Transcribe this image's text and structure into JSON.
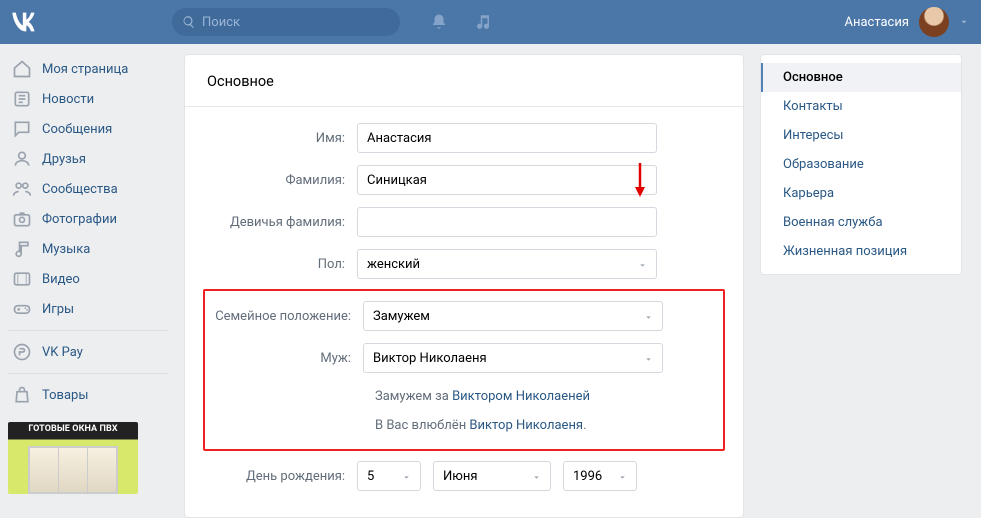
{
  "header": {
    "search_placeholder": "Поиск",
    "user_name": "Анастасия"
  },
  "leftnav": {
    "items": [
      {
        "label": "Моя страница",
        "icon": "home"
      },
      {
        "label": "Новости",
        "icon": "news"
      },
      {
        "label": "Сообщения",
        "icon": "messages"
      },
      {
        "label": "Друзья",
        "icon": "friends"
      },
      {
        "label": "Сообщества",
        "icon": "groups"
      },
      {
        "label": "Фотографии",
        "icon": "photos"
      },
      {
        "label": "Музыка",
        "icon": "music"
      },
      {
        "label": "Видео",
        "icon": "video"
      },
      {
        "label": "Игры",
        "icon": "games"
      }
    ],
    "items2": [
      {
        "label": "VK Pay",
        "icon": "pay"
      }
    ],
    "items3": [
      {
        "label": "Товары",
        "icon": "goods"
      }
    ],
    "ad_label": "ГОТОВЫЕ ОКНА ПВХ"
  },
  "form": {
    "section_title": "Основное",
    "name_label": "Имя:",
    "name_value": "Анастасия",
    "surname_label": "Фамилия:",
    "surname_value": "Синицкая",
    "maiden_label": "Девичья фамилия:",
    "maiden_value": "",
    "sex_label": "Пол:",
    "sex_value": "женский",
    "relation_label": "Семейное положение:",
    "relation_value": "Замужем",
    "spouse_label": "Муж:",
    "spouse_value": "Виктор Николаеня",
    "married_to_prefix": "Замужем за ",
    "married_to_link": "Виктором Николаеней",
    "inlove_prefix": "В Вас влюблён ",
    "inlove_link": "Виктор Николаеня",
    "inlove_suffix": ".",
    "dob_label": "День рождения:",
    "dob_day": "5",
    "dob_month": "Июня",
    "dob_year": "1996"
  },
  "rightnav": {
    "items": [
      "Основное",
      "Контакты",
      "Интересы",
      "Образование",
      "Карьера",
      "Военная служба",
      "Жизненная позиция"
    ]
  }
}
